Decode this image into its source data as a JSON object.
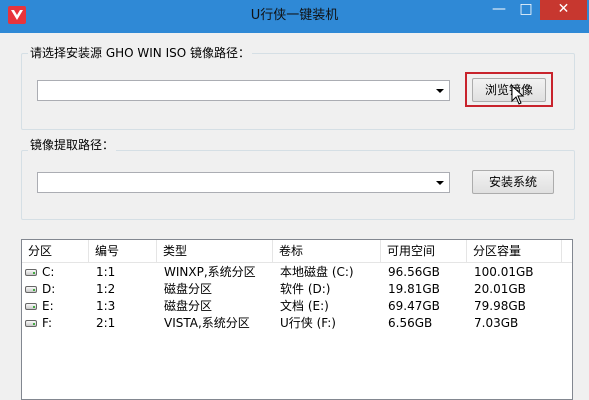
{
  "window": {
    "title": "U行侠一键装机"
  },
  "titlebar": {
    "min_glyph": "—",
    "max_glyph": "□",
    "close_glyph": "✕"
  },
  "source_group": {
    "label": "请选择安装源 GHO WIN ISO 镜像路径：",
    "path_value": "",
    "browse_label": "浏览镜像"
  },
  "extract_group": {
    "label": "镜像提取路径：",
    "path_value": "",
    "install_label": "安装系统"
  },
  "partition_table": {
    "columns": [
      "分区",
      "编号",
      "类型",
      "卷标",
      "可用空间",
      "分区容量"
    ],
    "rows": [
      {
        "drive": "C:",
        "num": "1:1",
        "type": "WINXP,系统分区",
        "label": "本地磁盘 (C:)",
        "free": "96.56GB",
        "size": "100.01GB"
      },
      {
        "drive": "D:",
        "num": "1:2",
        "type": "磁盘分区",
        "label": "软件 (D:)",
        "free": "19.81GB",
        "size": "20.01GB"
      },
      {
        "drive": "E:",
        "num": "1:3",
        "type": "磁盘分区",
        "label": "文档 (E:)",
        "free": "69.47GB",
        "size": "79.98GB"
      },
      {
        "drive": "F:",
        "num": "2:1",
        "type": "VISTA,系统分区",
        "label": "U行侠 (F:)",
        "free": "6.56GB",
        "size": "7.03GB"
      }
    ]
  },
  "colors": {
    "titlebar": "#2f89d6",
    "close": "#c7372f",
    "highlight": "#c8232c"
  },
  "icons": {
    "app": "app-logo-icon",
    "drive": "drive-icon",
    "cursor": "mouse-cursor-icon"
  }
}
